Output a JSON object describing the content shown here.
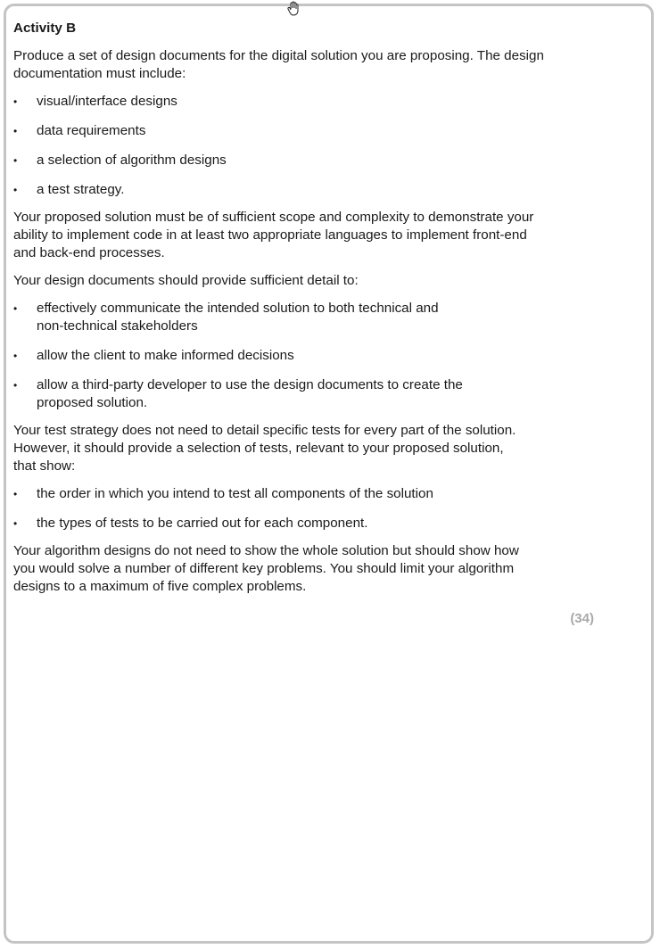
{
  "heading": "Activity B",
  "intro": "Produce a set of design documents for the digital solution you are proposing. The design\ndocumentation must include:",
  "list1": [
    "visual/interface designs",
    "data requirements",
    "a selection of algorithm designs",
    "a test strategy."
  ],
  "para_scope": "Your proposed solution must be of sufficient scope and complexity to demonstrate your\nability to implement code in at least two appropriate languages to implement front-end\nand back-end processes.",
  "para_detail": "Your design documents should provide sufficient detail to:",
  "list2": [
    "effectively communicate the intended solution to both technical and\nnon-technical stakeholders",
    "allow the client to make informed decisions",
    "allow a third-party developer to use the design documents to create the\nproposed solution."
  ],
  "para_test": "Your test strategy does not need to detail specific tests for every part of the solution.\nHowever, it should provide a selection of tests, relevant to your proposed solution,\nthat show:",
  "list3": [
    "the order in which you intend to test all components of the solution",
    "the types of tests to be carried out for each component."
  ],
  "para_algo": "Your algorithm designs do not need to show the whole solution but should show how\nyou would solve a number of different key problems. You should limit your algorithm\ndesigns to a maximum of five complex problems.",
  "marks": "(34)",
  "bullet_char": "•",
  "cursor_icon": "hand-pointer-icon"
}
